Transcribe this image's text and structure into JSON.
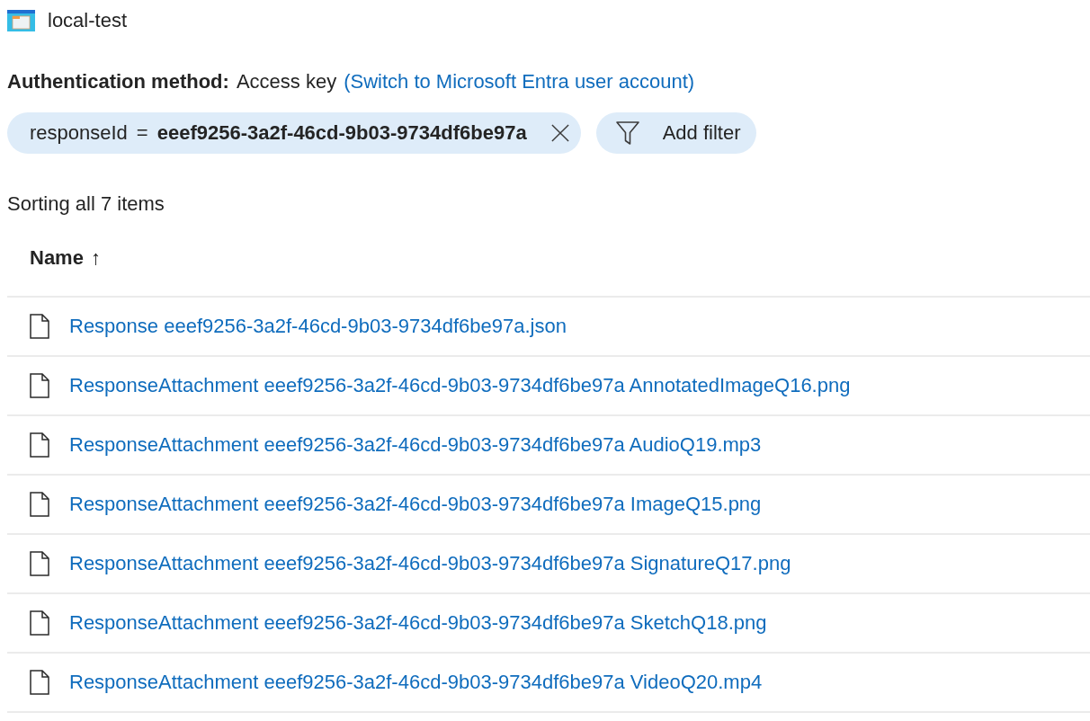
{
  "header": {
    "title": "local-test"
  },
  "authentication": {
    "label": "Authentication method:",
    "value": "Access key",
    "switch_link": "(Switch to Microsoft Entra user account)"
  },
  "filters": [
    {
      "field": "responseId",
      "operator": "=",
      "value": "eeef9256-3a2f-46cd-9b03-9734df6be97a"
    }
  ],
  "add_filter_button": {
    "label": "Add filter"
  },
  "summary": "Sorting all 7 items",
  "table": {
    "columns": [
      {
        "label": "Name",
        "sort_indicator": "↑"
      }
    ],
    "rows": [
      {
        "name": "Response eeef9256-3a2f-46cd-9b03-9734df6be97a.json"
      },
      {
        "name": "ResponseAttachment eeef9256-3a2f-46cd-9b03-9734df6be97a AnnotatedImageQ16.png"
      },
      {
        "name": "ResponseAttachment eeef9256-3a2f-46cd-9b03-9734df6be97a AudioQ19.mp3"
      },
      {
        "name": "ResponseAttachment eeef9256-3a2f-46cd-9b03-9734df6be97a ImageQ15.png"
      },
      {
        "name": "ResponseAttachment eeef9256-3a2f-46cd-9b03-9734df6be97a SignatureQ17.png"
      },
      {
        "name": "ResponseAttachment eeef9256-3a2f-46cd-9b03-9734df6be97a SketchQ18.png"
      },
      {
        "name": "ResponseAttachment eeef9256-3a2f-46cd-9b03-9734df6be97a VideoQ20.mp4"
      }
    ]
  }
}
